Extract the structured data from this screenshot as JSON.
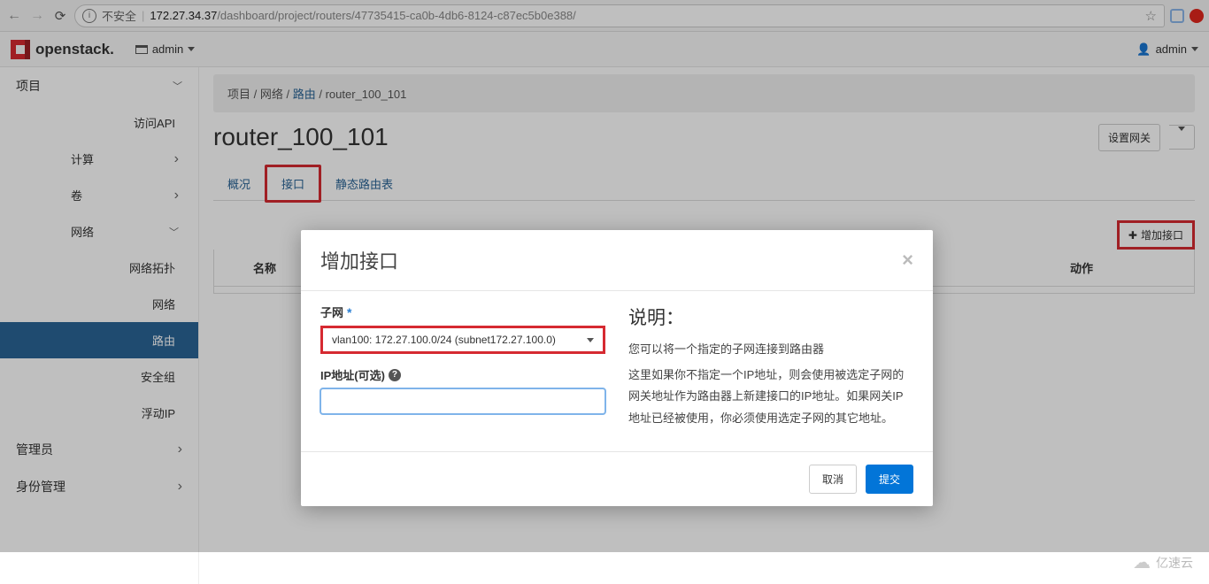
{
  "browser": {
    "insecure_label": "不安全",
    "url_host": "172.27.34.37",
    "url_path": "/dashboard/project/routers/47735415-ca0b-4db6-8124-c87ec5b0e388/"
  },
  "topbar": {
    "brand": "openstack.",
    "project": "admin",
    "user": "admin"
  },
  "sidebar": {
    "project": "项目",
    "api": "访问API",
    "compute": "计算",
    "volume": "卷",
    "network": "网络",
    "topology": "网络拓扑",
    "net": "网络",
    "router": "路由",
    "secgroup": "安全组",
    "floatip": "浮动IP",
    "admin": "管理员",
    "identity": "身份管理"
  },
  "breadcrumb": {
    "a": "项目",
    "b": "网络",
    "c": "路由",
    "d": "router_100_101"
  },
  "page": {
    "title": "router_100_101",
    "set_gateway": "设置网关"
  },
  "tabs": {
    "overview": "概况",
    "interface": "接口",
    "static": "静态路由表"
  },
  "toolbar": {
    "add_interface": "增加接口"
  },
  "table": {
    "name": "名称",
    "op": "动作"
  },
  "modal": {
    "title": "增加接口",
    "subnet_label": "子网",
    "subnet_value": "vlan100: 172.27.100.0/24 (subnet172.27.100.0)",
    "ip_label": "IP地址(可选)",
    "ip_value": "",
    "desc_title": "说明：",
    "desc_p1": "您可以将一个指定的子网连接到路由器",
    "desc_p2": "这里如果你不指定一个IP地址，则会使用被选定子网的网关地址作为路由器上新建接口的IP地址。如果网关IP地址已经被使用，你必须使用选定子网的其它地址。",
    "cancel": "取消",
    "submit": "提交"
  },
  "watermark": "亿速云"
}
